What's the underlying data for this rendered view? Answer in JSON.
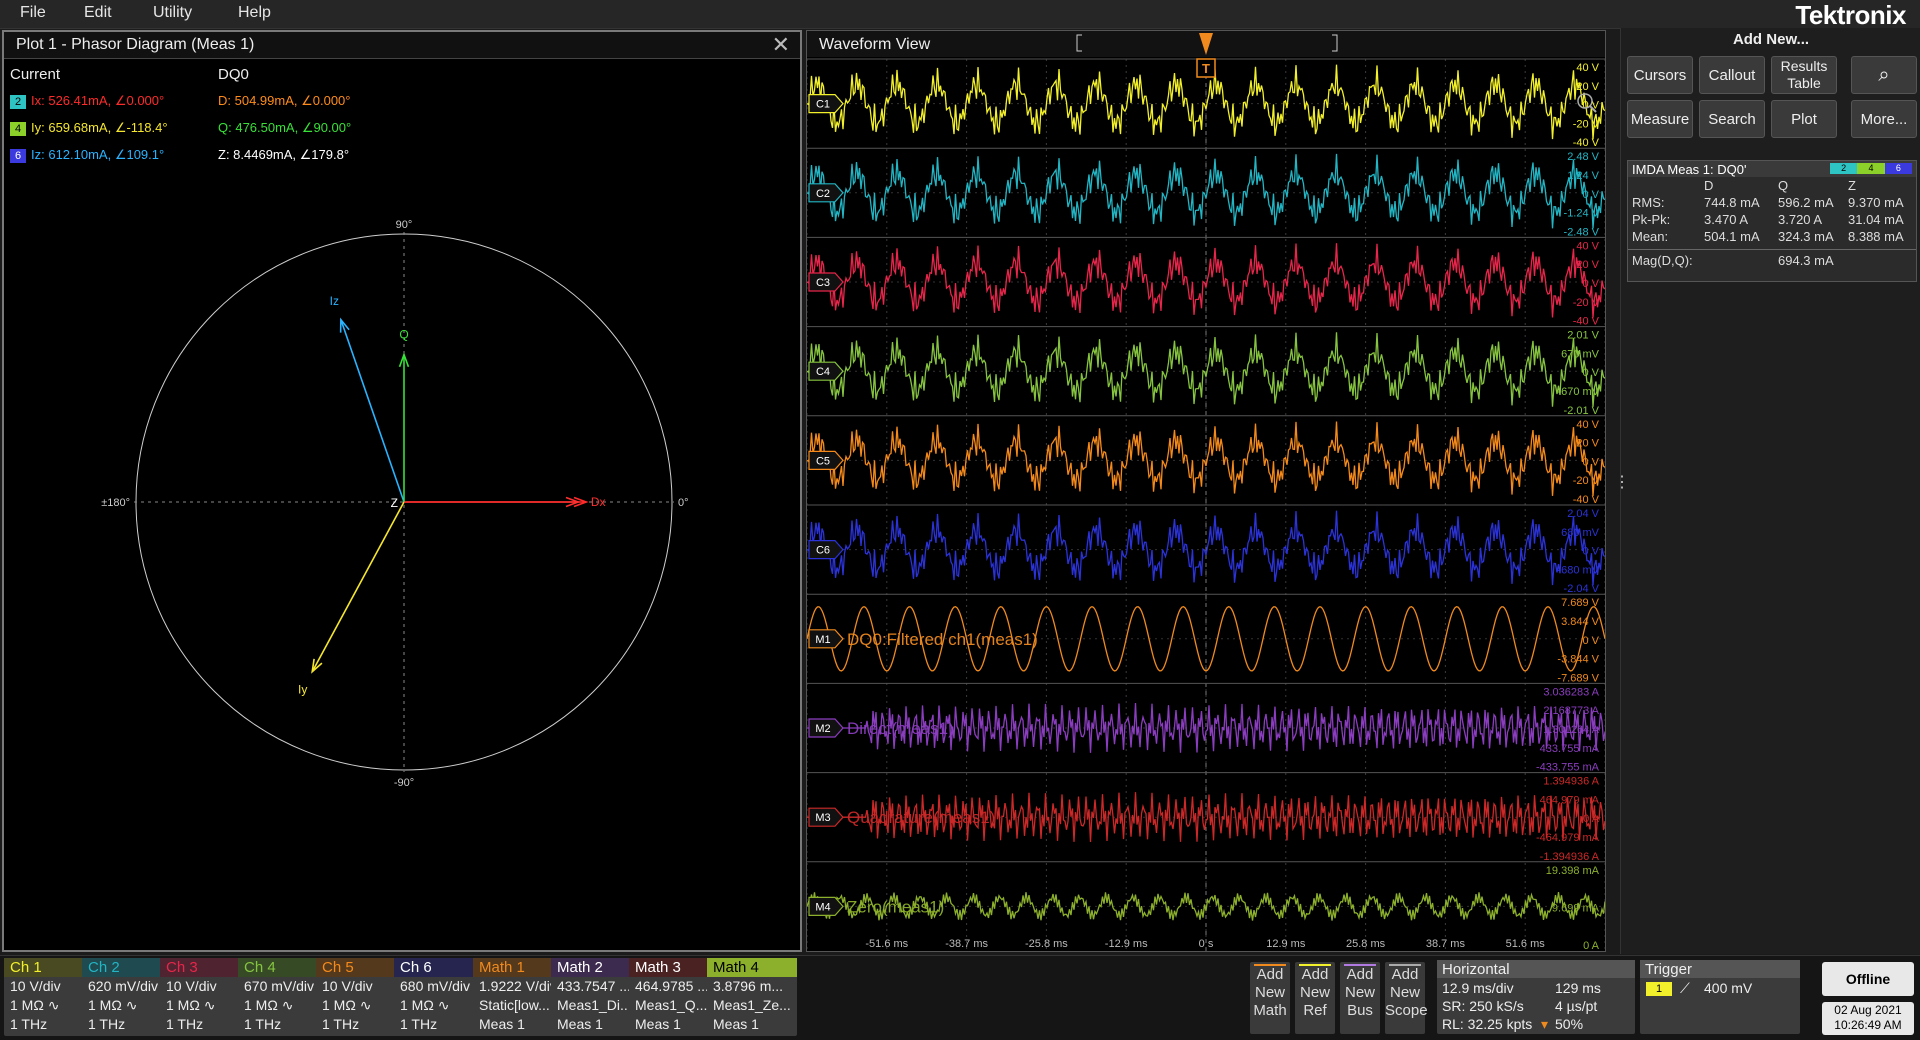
{
  "menu": [
    "File",
    "Edit",
    "Utility",
    "Help"
  ],
  "brand": "Tektronix",
  "phasor": {
    "title": "Plot 1 - Phasor Diagram (Meas 1)",
    "current_header": "Current",
    "dq0_header": "DQ0",
    "rows": [
      {
        "badge": "2",
        "badge_color": "#2ec4c4",
        "label": "Ix: 526.41mA, ∠0.000°",
        "color": "#ff2a2a",
        "dq_label": "D: 504.99mA, ∠0.000°",
        "dq_color": "#ff8c1a"
      },
      {
        "badge": "4",
        "badge_color": "#8bd12a",
        "label": "Iy: 659.68mA, ∠-118.4°",
        "color": "#f5e62e",
        "dq_label": "Q: 476.50mA, ∠90.00°",
        "dq_color": "#38e038"
      },
      {
        "badge": "6",
        "badge_color": "#3a3adf",
        "label": "Iz: 612.10mA, ∠109.1°",
        "color": "#2ab3ff",
        "dq_label": "Z: 8.4469mA, ∠179.8°",
        "dq_color": "#ffffff"
      }
    ],
    "axis": {
      "top": "90°",
      "bottom": "-90°",
      "left": "±180°",
      "right": "0°"
    },
    "vectors": [
      {
        "name": "Ix",
        "angle": 0,
        "mag": 526.41,
        "color": "#ff2a2a",
        "label": ""
      },
      {
        "name": "Iy",
        "angle": -118.4,
        "mag": 659.68,
        "color": "#f5e62e",
        "label": "Iy"
      },
      {
        "name": "Iz",
        "angle": 109.1,
        "mag": 612.1,
        "color": "#2ab3ff",
        "label": "Iz"
      },
      {
        "name": "D",
        "angle": 0,
        "mag": 504.99,
        "color": "#ff3030",
        "label": "Dx"
      },
      {
        "name": "Q",
        "angle": 90,
        "mag": 476.5,
        "color": "#38e038",
        "label": "Q"
      }
    ],
    "center_label": "Z"
  },
  "waveform": {
    "title": "Waveform View",
    "time_labels": [
      "-51.6 ms",
      "-38.7 ms",
      "-25.8 ms",
      "-12.9 ms",
      "0 s",
      "12.9 ms",
      "25.8 ms",
      "38.7 ms",
      "51.6 ms"
    ],
    "trigger_marker": "T",
    "lanes": [
      {
        "id": "C1",
        "color": "#f2f02a",
        "scale": [
          "40 V",
          "20 V",
          "0 V",
          "-20 V",
          "-40 V"
        ],
        "name": ""
      },
      {
        "id": "C2",
        "color": "#22b5c4",
        "scale": [
          "2.48 V",
          "1.24 V",
          "0 V",
          "-1.24 V",
          "-2.48 V"
        ],
        "name": ""
      },
      {
        "id": "C3",
        "color": "#e8254a",
        "scale": [
          "40 V",
          "20 V",
          "0 V",
          "-20 V",
          "-40 V"
        ],
        "name": ""
      },
      {
        "id": "C4",
        "color": "#86c440",
        "scale": [
          "2.01 V",
          "670 mV",
          "0 V",
          "-670 mV",
          "-2.01 V"
        ],
        "name": ""
      },
      {
        "id": "C5",
        "color": "#f58a1a",
        "scale": [
          "40 V",
          "20 V",
          "0 V",
          "-20 V",
          "-40 V"
        ],
        "name": ""
      },
      {
        "id": "C6",
        "color": "#2b32d8",
        "scale": [
          "2.04 V",
          "680 mV",
          "0 V",
          "-680 mV",
          "-2.04 V"
        ],
        "name": ""
      },
      {
        "id": "M1",
        "color": "#f08a1e",
        "scale": [
          "7.689 V",
          "3.844 V",
          "0 V",
          "-3.844 V",
          "-7.689 V"
        ],
        "name": "DQ0:Filtered ch1(meas1)"
      },
      {
        "id": "M2",
        "color": "#8b3dbf",
        "scale": [
          "3.036283 A",
          "2.168773 A",
          "1.301264 A",
          "433.755 mA",
          "-433.755 mA"
        ],
        "name": "Direct(meas1)"
      },
      {
        "id": "M3",
        "color": "#cc2828",
        "scale": [
          "1.394936 A",
          "464.979 mA",
          "0 A",
          "-464.979 mA",
          "-1.394936 A"
        ],
        "name": "Quadrature(meas1)"
      },
      {
        "id": "M4",
        "color": "#8cb02c",
        "scale": [
          "19.398 mA",
          "9.699 mA",
          "0 A"
        ],
        "name": "Zero(meas1)"
      }
    ]
  },
  "right": {
    "add_new": "Add New...",
    "buttons": [
      "Cursors",
      "Callout",
      "Results Table",
      "Measure",
      "Search",
      "Plot",
      "More..."
    ],
    "meas": {
      "title": "IMDA Meas 1: DQ0'",
      "badges": [
        "2",
        "4",
        "6"
      ],
      "cols": [
        "D",
        "Q",
        "Z"
      ],
      "rows": [
        {
          "label": "RMS:",
          "vals": [
            "744.8 mA",
            "596.2 mA",
            "9.370 mA"
          ]
        },
        {
          "label": "Pk-Pk:",
          "vals": [
            "3.470 A",
            "3.720 A",
            "31.04 mA"
          ]
        },
        {
          "label": "Mean:",
          "vals": [
            "504.1 mA",
            "324.3 mA",
            "8.388 mA"
          ]
        }
      ],
      "mag_label": "Mag(D,Q):",
      "mag_value": "694.3 mA"
    }
  },
  "channels": [
    {
      "name": "Ch 1",
      "color": "#f2f02a",
      "bg": "#4a4a22",
      "l1": "10 V/div",
      "l2": "1 MΩ  ∿",
      "l3": "1 THz"
    },
    {
      "name": "Ch 2",
      "color": "#22b5c4",
      "bg": "#1f4a4f",
      "l1": "620 mV/div",
      "l2": "1 MΩ  ∿",
      "l3": "1 THz"
    },
    {
      "name": "Ch 3",
      "color": "#e8254a",
      "bg": "#4f2430",
      "l1": "10 V/div",
      "l2": "1 MΩ  ∿",
      "l3": "1 THz"
    },
    {
      "name": "Ch 4",
      "color": "#86c440",
      "bg": "#354a25",
      "l1": "670 mV/div",
      "l2": "1 MΩ  ∿",
      "l3": "1 THz"
    },
    {
      "name": "Ch 5",
      "color": "#f58a1a",
      "bg": "#55391c",
      "l1": "10 V/div",
      "l2": "1 MΩ  ∿",
      "l3": "1 THz"
    },
    {
      "name": "Ch 6",
      "color": "#ffffff",
      "bg": "#252550",
      "l1": "680 mV/div",
      "l2": "1 MΩ  ∿",
      "l3": "1 THz"
    },
    {
      "name": "Math 1",
      "color": "#f08a1e",
      "bg": "#55391c",
      "l1": "1.9222 V/div",
      "l2": "Static[low...",
      "l3": "Meas 1"
    },
    {
      "name": "Math 2",
      "color": "#ffffff",
      "bg": "#3d2a4f",
      "l1": "433.7547 ...",
      "l2": "Meas1_Di...",
      "l3": "Meas 1"
    },
    {
      "name": "Math 3",
      "color": "#ffffff",
      "bg": "#4a2222",
      "l1": "464.9785 ...",
      "l2": "Meas1_Q...",
      "l3": "Meas 1"
    },
    {
      "name": "Math 4",
      "color": "#000000",
      "bg": "#8cb02c",
      "l1": "3.8796 m...",
      "l2": "Meas1_Ze...",
      "l3": "Meas 1"
    }
  ],
  "add_buttons": [
    {
      "label": [
        "Add",
        "New",
        "Math"
      ],
      "color": "#f08a1e"
    },
    {
      "label": [
        "Add",
        "New",
        "Ref"
      ],
      "color": "#f2f02a"
    },
    {
      "label": [
        "Add",
        "New",
        "Bus"
      ],
      "color": "#b07ae0"
    },
    {
      "label": [
        "Add",
        "New",
        "Scope"
      ],
      "color": "#aaaaaa"
    }
  ],
  "horizontal": {
    "title": "Horizontal",
    "scale": "12.9 ms/div",
    "pos": "129 ms",
    "sr": "SR: 250 kS/s",
    "pt": "4 µs/pt",
    "rl": "RL: 32.25 kpts",
    "pct": "50%"
  },
  "trigger": {
    "title": "Trigger",
    "source": "1",
    "level": "400 mV"
  },
  "status": {
    "offline": "Offline",
    "date": "02 Aug 2021",
    "time": "10:26:49 AM"
  }
}
